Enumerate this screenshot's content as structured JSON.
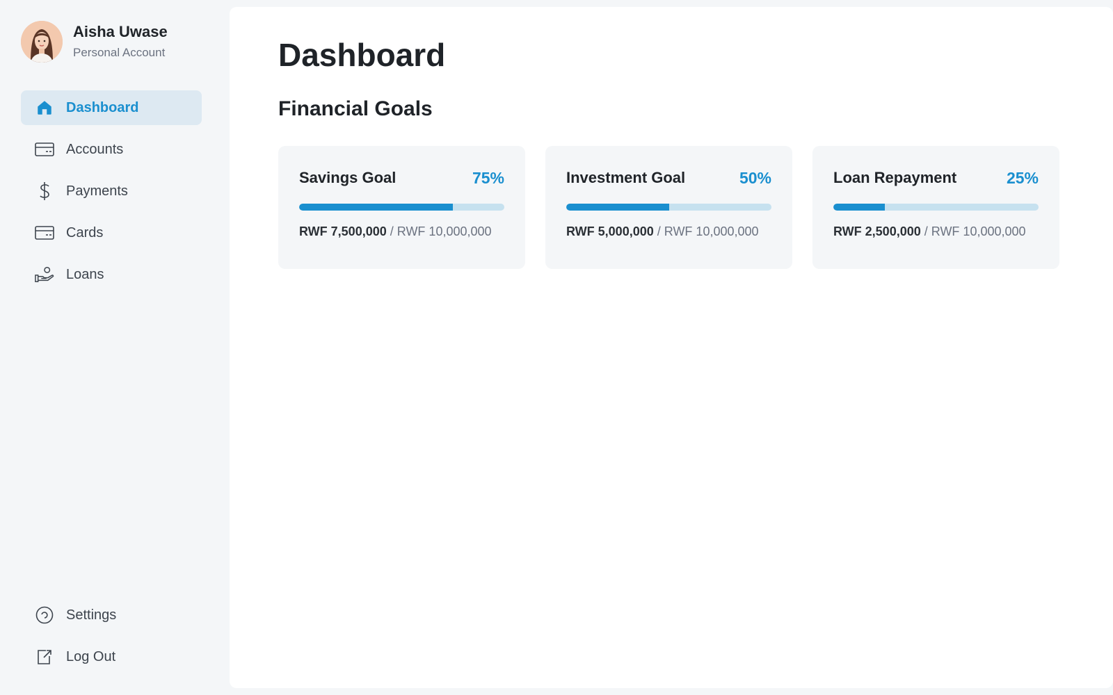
{
  "profile": {
    "name": "Aisha Uwase",
    "account_type": "Personal Account"
  },
  "nav": {
    "items": [
      {
        "label": "Dashboard",
        "icon": "home-icon",
        "active": true
      },
      {
        "label": "Accounts",
        "icon": "card-icon",
        "active": false
      },
      {
        "label": "Payments",
        "icon": "dollar-icon",
        "active": false
      },
      {
        "label": "Cards",
        "icon": "card-icon",
        "active": false
      },
      {
        "label": "Loans",
        "icon": "hand-coin-icon",
        "active": false
      }
    ],
    "bottom": [
      {
        "label": "Settings",
        "icon": "settings-icon"
      },
      {
        "label": "Log Out",
        "icon": "logout-icon"
      }
    ]
  },
  "main": {
    "title": "Dashboard",
    "section_title": "Financial Goals",
    "goals": [
      {
        "title": "Savings Goal",
        "percent_label": "75%",
        "progress": 0.75,
        "current": "RWF 7,500,000",
        "target": "/ RWF 10,000,000"
      },
      {
        "title": "Investment Goal",
        "percent_label": "50%",
        "progress": 0.5,
        "current": "RWF 5,000,000",
        "target": "/ RWF 10,000,000"
      },
      {
        "title": "Loan Repayment",
        "percent_label": "25%",
        "progress": 0.25,
        "current": "RWF 2,500,000",
        "target": "/ RWF 10,000,000"
      }
    ]
  },
  "colors": {
    "accent": "#1a8fcf",
    "active_bg": "#dde9f2",
    "bar_track": "#c6e1ef",
    "page_bg": "#f4f6f8"
  }
}
